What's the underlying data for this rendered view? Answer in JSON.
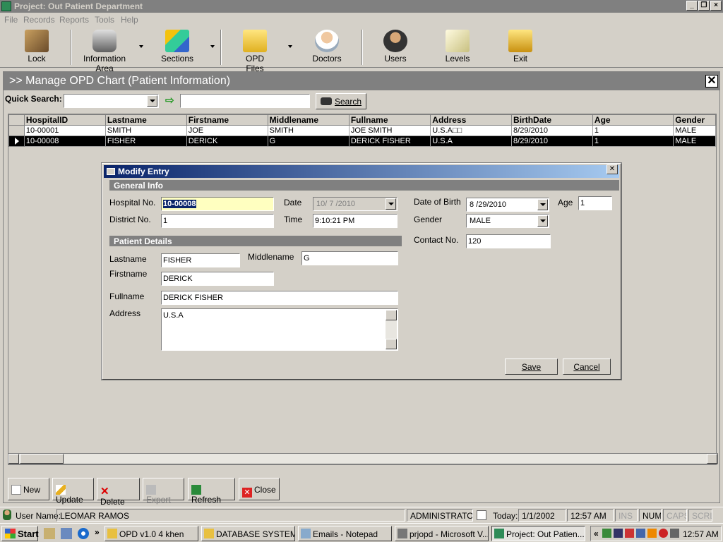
{
  "window": {
    "title": "Project: Out Patient Department",
    "accent": "#808080"
  },
  "menu": [
    "File",
    "Records",
    "Reports",
    "Tools",
    "Help"
  ],
  "toolbar": {
    "items": [
      {
        "label": "Lock",
        "icon": "key-icon"
      },
      {
        "label": "Information Area",
        "icon": "database-icon"
      },
      {
        "label": "Sections",
        "icon": "blocks-icon"
      },
      {
        "label": "OPD Files",
        "icon": "folder-icon"
      },
      {
        "label": "Doctors",
        "icon": "doctor-icon"
      },
      {
        "label": "Users",
        "icon": "user-icon"
      },
      {
        "label": "Levels",
        "icon": "levels-icon"
      },
      {
        "label": "Exit",
        "icon": "exit-icon"
      }
    ]
  },
  "mdi": {
    "title": ">> Manage OPD Chart (Patient Information)",
    "quick_search_label": "Quick Search:",
    "search_value": "",
    "combo_value": "",
    "search_button": "Search"
  },
  "grid": {
    "columns": [
      "HospitalID",
      "Lastname",
      "Firstname",
      "Middlename",
      "Fullname",
      "Address",
      "BirthDate",
      "Age",
      "Gender"
    ],
    "rows": [
      [
        "10-00001",
        "SMITH",
        "JOE",
        "SMITH",
        "JOE SMITH",
        "U.S.A□□",
        "8/29/2010",
        "1",
        "MALE"
      ],
      [
        "10-00008",
        "FISHER",
        "DERICK",
        "G",
        "DERICK FISHER",
        "U.S.A",
        "8/29/2010",
        "1",
        "MALE"
      ]
    ],
    "selected_row": 1
  },
  "bottom_buttons": {
    "new": "New",
    "update": "Update",
    "delete": "Delete",
    "export": "Export",
    "refresh": "Refresh",
    "close": "Close"
  },
  "dialog": {
    "title": "Modify Entry",
    "general_info": "General Info",
    "patient_details": "Patient Details",
    "labels": {
      "hospital_no": "Hospital No.",
      "district_no": "District No.",
      "date": "Date",
      "time": "Time",
      "dob": "Date of Birth",
      "age": "Age",
      "gender": "Gender",
      "contact": "Contact No.",
      "lastname": "Lastname",
      "middlename": "Middlename",
      "firstname": "Firstname",
      "fullname": "Fullname",
      "address": "Address"
    },
    "values": {
      "hospital_no": "10-00008",
      "district_no": "1",
      "date": "10/ 7 /2010",
      "time": "9:10:21 PM",
      "dob": "8 /29/2010",
      "age": "1",
      "gender": "MALE",
      "contact": "120",
      "lastname": "FISHER",
      "middlename": "G",
      "firstname": "DERICK",
      "fullname": "DERICK FISHER",
      "address": "U.S.A"
    },
    "save": "Save",
    "cancel": "Cancel"
  },
  "status": {
    "user_label": "User Name:",
    "user": "LEOMAR RAMOS",
    "role": "ADMINISTRATOR",
    "today_label": "Today:",
    "today": "1/1/2002",
    "time": "12:57 AM",
    "ins": "INS",
    "num": "NUM",
    "caps": "CAPS",
    "scrl": "SCRL"
  },
  "taskbar": {
    "start": "Start",
    "more": "»",
    "tasks": [
      {
        "label": "OPD v1.0 4 khen",
        "icon": "folder-icon"
      },
      {
        "label": "DATABASE SYSTEMS",
        "icon": "folder-icon"
      },
      {
        "label": "Emails - Notepad",
        "icon": "notepad-icon"
      },
      {
        "label": "prjopd - Microsoft V...",
        "icon": "vb-icon"
      },
      {
        "label": "Project: Out Patien...",
        "icon": "app-icon"
      }
    ],
    "tray_more": "«",
    "clock": "12:57 AM"
  }
}
